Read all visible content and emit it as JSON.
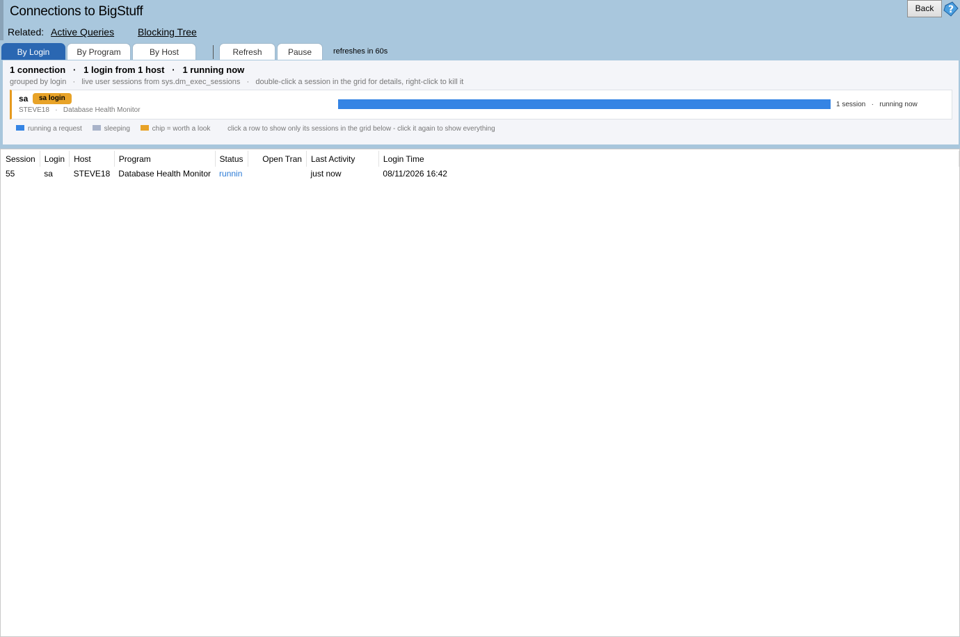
{
  "header": {
    "title": "Connections to BigStuff",
    "related_label": "Related:",
    "related_links": [
      "Active Queries",
      "Blocking Tree"
    ],
    "back_label": "Back"
  },
  "tabs": [
    "By Login",
    "By Program",
    "By Host"
  ],
  "actions": {
    "refresh_label": "Refresh",
    "pause_label": "Pause",
    "refresh_note": "refreshes in 60s"
  },
  "summary": {
    "title": "1 connection   ·   1 login from 1 host   ·   1 running now",
    "subtitle": "grouped by login   ·   live user sessions from sys.dm_exec_sessions   ·   double-click a session in the grid for details, right-click to kill it"
  },
  "card": {
    "login": "sa",
    "chip": "sa login",
    "meta": "STEVE18   ·   Database Health Monitor",
    "count": "1 session   ·   running now",
    "running_fraction": 1.0
  },
  "legend": {
    "running": "running a request",
    "sleeping": "sleeping",
    "chip": "chip = worth a look",
    "hint": "click a row to show only its sessions in the grid below - click it again to show everything"
  },
  "colors": {
    "accent": "#2a67b2",
    "running": "#3584e4",
    "sleeping": "#a9b3c9",
    "chip": "#e8a328"
  },
  "grid": {
    "columns": [
      "Session",
      "Login",
      "Host",
      "Program",
      "Status",
      "Open Tran",
      "Last Activity",
      "Login Time"
    ],
    "rows": [
      {
        "session": "55",
        "login": "sa",
        "host": "STEVE18",
        "program": "Database Health Monitor",
        "status": "runnin",
        "open_tran": "",
        "last_activity": "just now",
        "login_time": "08/11/2026 16:42"
      }
    ]
  }
}
